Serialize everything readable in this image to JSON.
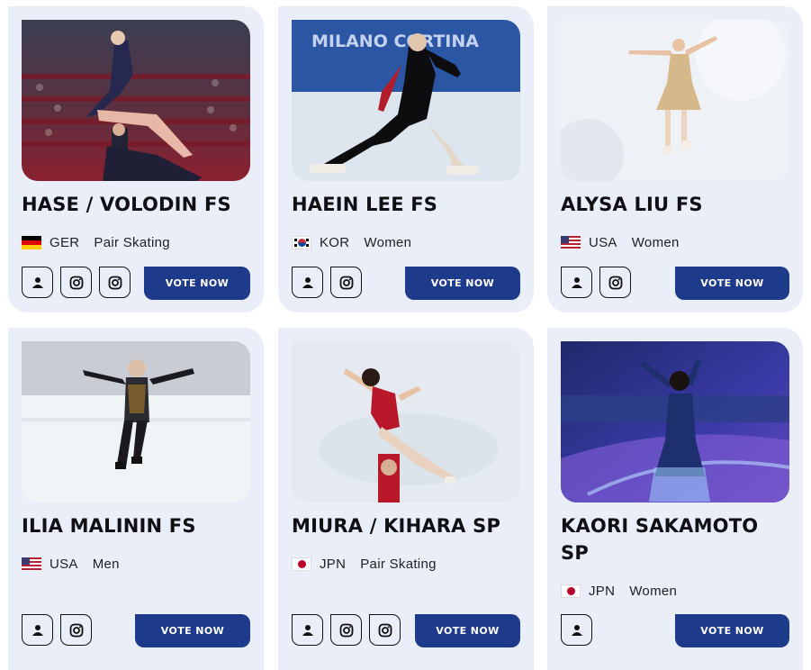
{
  "cards": [
    {
      "name": "HASE / VOLODIN FS",
      "country": "GER",
      "category": "Pair Skating",
      "vote_label": "VOTE NOW",
      "photo": {
        "bg_top": "#3a3f52",
        "bg_bottom": "#8c2030",
        "ice": "#d8e2ee",
        "costume": "#26284f"
      }
    },
    {
      "name": "HAEIN LEE FS",
      "country": "KOR",
      "category": "Women",
      "vote_label": "VOTE NOW",
      "photo": {
        "banner_text": "MILANO CORTINA",
        "banner_color": "#2b56a3",
        "ice": "#dde6ef",
        "costume": "#0d0d0f"
      }
    },
    {
      "name": "ALYSA LIU FS",
      "country": "USA",
      "category": "Women",
      "vote_label": "VOTE NOW",
      "photo": {
        "bg_top": "#f0f3f7",
        "ice": "#e9eef3",
        "costume": "#d6b98a"
      }
    },
    {
      "name": "ILIA MALININ FS",
      "country": "USA",
      "category": "Men",
      "vote_label": "VOTE NOW",
      "photo": {
        "bg_top": "#a8abb2",
        "ice": "#eef1f5",
        "costume": "#1b1b1f"
      }
    },
    {
      "name": "MIURA / KIHARA SP",
      "country": "JPN",
      "category": "Pair Skating",
      "vote_label": "VOTE NOW",
      "photo": {
        "bg_top": "#e4eaf0",
        "ice": "#e1e8ef",
        "costume": "#b8182a"
      }
    },
    {
      "name": "KAORI SAKAMOTO SP",
      "country": "JPN",
      "category": "Women",
      "vote_label": "VOTE NOW",
      "photo": {
        "bg_top": "#1e2a6a",
        "ice": "#6a4cc0",
        "costume": "#1e2f6e"
      }
    }
  ],
  "colors": {
    "card_bg": "#e9eef8",
    "vote_bg": "#1e3a8a",
    "vote_text": "#ffffff"
  }
}
